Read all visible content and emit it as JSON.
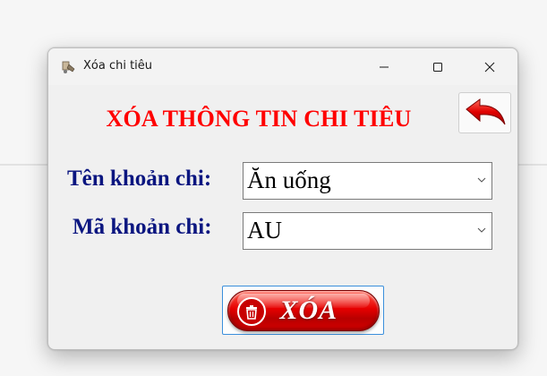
{
  "window": {
    "title": "Xóa chi tiêu"
  },
  "form": {
    "heading": "XÓA THÔNG TIN CHI TIÊU",
    "name_label": "Tên khoản chi:",
    "name_value": "Ăn uống",
    "code_label": "Mã khoản chi:",
    "code_value": "AU",
    "delete_label": "XÓA"
  },
  "icons": {
    "app": "app-icon",
    "minimize": "minimize-icon",
    "maximize": "maximize-icon",
    "close": "close-icon",
    "back": "back-arrow-icon",
    "dropdown": "chevron-down-icon",
    "delete": "trash-icon"
  },
  "colors": {
    "heading": "#ff0000",
    "label": "#0b1680",
    "button_red": "#e60000",
    "button_focus_border": "#3b8fdc"
  }
}
